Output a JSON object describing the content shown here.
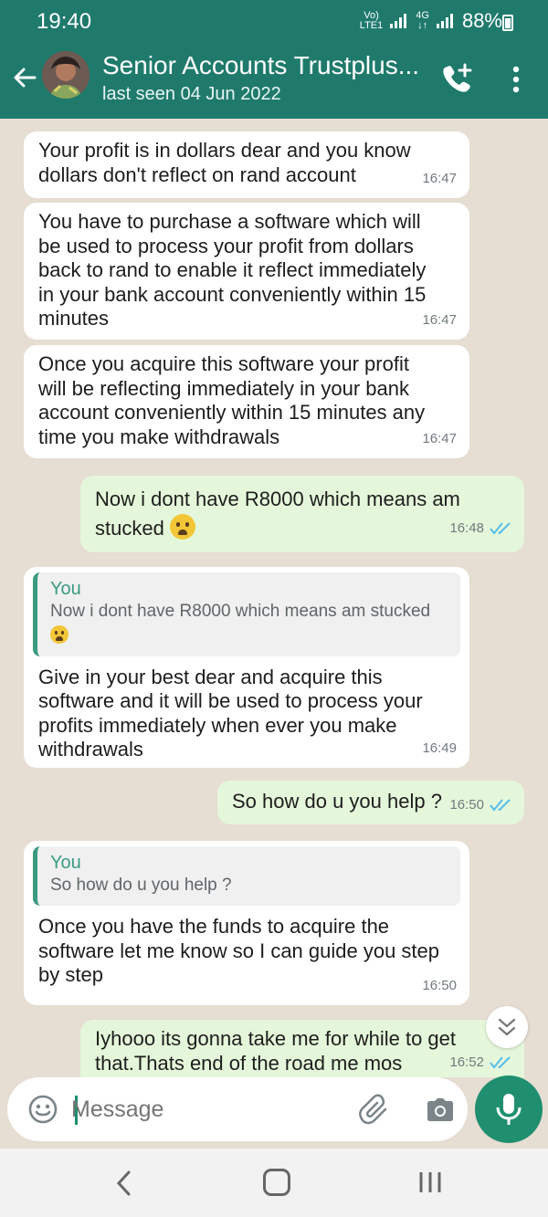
{
  "status_bar": {
    "time": "19:40",
    "network_top": "Vo)",
    "network_bottom": "LTE1",
    "gen_top": "4G",
    "gen_bottom": "↓↑",
    "battery": "88%"
  },
  "header": {
    "title": "Senior Accounts Trustplus...",
    "subtitle": "last seen 04 Jun 2022"
  },
  "messages": [
    {
      "direction": "incoming",
      "lines": [
        "Your profit is in dollars dear and you know",
        "dollars don't reflect on rand account"
      ],
      "time": "16:47"
    },
    {
      "direction": "incoming",
      "lines": [
        "You have to purchase a software which will",
        "be used to process your profit from dollars",
        "back to rand to enable it reflect immediately",
        "in your bank account conveniently within 15",
        "minutes"
      ],
      "time": "16:47"
    },
    {
      "direction": "incoming",
      "lines": [
        "Once you acquire this software your profit",
        "will be reflecting immediately in your bank",
        "account conveniently within 15 minutes any",
        "time you make withdrawals"
      ],
      "time": "16:47"
    },
    {
      "direction": "outgoing",
      "lines": [
        "Now i dont have R8000 which means am",
        "stucked"
      ],
      "emoji": "crying-face",
      "time": "16:48",
      "status": "read"
    },
    {
      "direction": "incoming",
      "quote": {
        "name": "You",
        "text": "Now i dont have R8000 which means am stucked",
        "emoji": "crying-face"
      },
      "lines": [
        "Give in your best dear and acquire this",
        "software and it will be used to process your",
        "profits immediately when ever you make",
        "withdrawals"
      ],
      "time": "16:49"
    },
    {
      "direction": "outgoing",
      "lines": [
        "So how do u you help ?"
      ],
      "time": "16:50",
      "status": "read"
    },
    {
      "direction": "incoming",
      "quote": {
        "name": "You",
        "text": "So how do u you help ?"
      },
      "lines": [
        "Once you have the funds to acquire the",
        "software let me know so I can guide you step",
        "by step"
      ],
      "time": "16:50"
    },
    {
      "direction": "outgoing",
      "lines": [
        "Iyhooo its gonna take me for while to get",
        "that.Thats end of the road me mos"
      ],
      "time": "16:52",
      "status": "read"
    }
  ],
  "composer": {
    "placeholder": "Message"
  },
  "colors": {
    "header": "#1f7a6c",
    "accent": "#1f8f6f",
    "incoming": "#ffffff",
    "outgoing": "#e5f7da",
    "read_ticks": "#53bdeb",
    "wallpaper": "#e6ddd3"
  },
  "icons": [
    "back-arrow-icon",
    "add-call-icon",
    "more-vert-icon",
    "emoji-icon",
    "attach-icon",
    "camera-icon",
    "mic-icon",
    "scroll-down-icon",
    "nav-back-icon",
    "nav-home-icon",
    "nav-recents-icon"
  ]
}
